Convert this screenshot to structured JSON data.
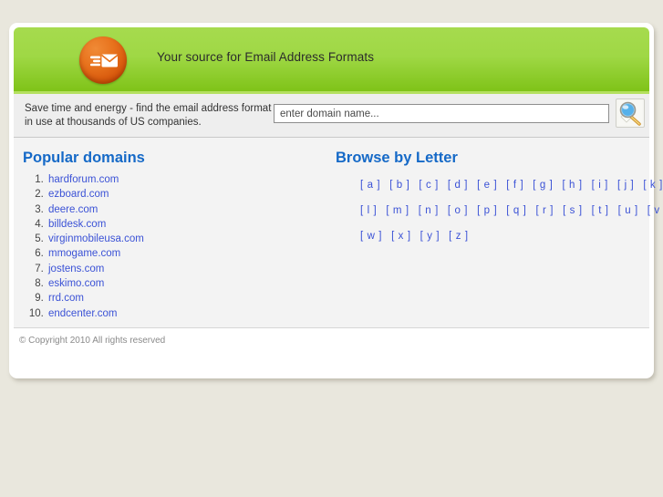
{
  "header": {
    "title": "Your source for Email Address Formats",
    "logo_icon": "envelope-speed-lines-icon",
    "brand_color": "#e8731d",
    "band_color": "#9fd845"
  },
  "search": {
    "tagline_line1": "Save time and energy - find the email address format",
    "tagline_line2": "in use at thousands of US companies.",
    "placeholder": "enter domain name...",
    "value": "",
    "button_icon": "magnifier-icon"
  },
  "popular": {
    "heading": "Popular domains",
    "heading_color": "#1569c7",
    "link_color": "#3b52d6",
    "domains": [
      "hardforum.com",
      "ezboard.com",
      "deere.com",
      "billdesk.com",
      "virginmobileusa.com",
      "mmogame.com",
      "jostens.com",
      "eskimo.com",
      "rrd.com",
      "endcenter.com"
    ]
  },
  "browse": {
    "heading": "Browse by Letter",
    "rows": [
      [
        "[ a ]",
        "[ b ]",
        "[ c ]",
        "[ d ]",
        "[ e ]",
        "[ f ]",
        "[ g ]",
        "[ h ]",
        "[ i ]",
        "[ j ]",
        "[ k ]"
      ],
      [
        "[ l ]",
        "[ m ]",
        "[ n ]",
        "[ o ]",
        "[ p ]",
        "[ q ]",
        "[ r ]",
        "[ s ]",
        "[ t ]",
        "[ u ]",
        "[ v ]"
      ],
      [
        "[ w ]",
        "[ x ]",
        "[ y ]",
        "[ z ]"
      ]
    ]
  },
  "footer": {
    "copyright": "© Copyright 2010 All rights reserved"
  }
}
